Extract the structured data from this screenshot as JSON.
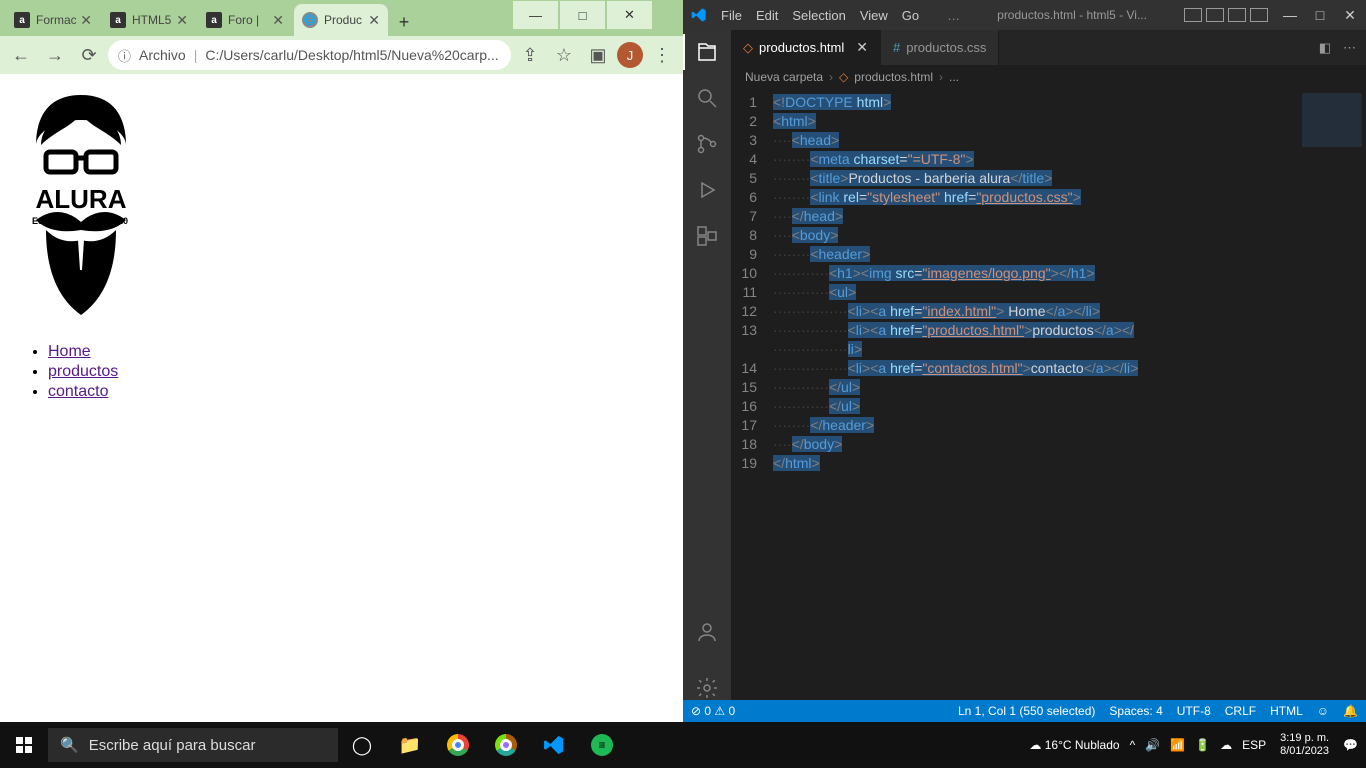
{
  "chrome": {
    "tabs": [
      {
        "title": "Formac",
        "icon": "a"
      },
      {
        "title": "HTML5",
        "icon": "a"
      },
      {
        "title": "Foro |",
        "icon": "a"
      },
      {
        "title": "Produc",
        "icon": "globe",
        "active": true
      }
    ],
    "url_label": "Archivo",
    "url": "C:/Users/carlu/Desktop/html5/Nueva%20carp...",
    "profile": "J",
    "nav": [
      {
        "text": " Home",
        "href": "index.html"
      },
      {
        "text": "productos",
        "href": "productos.html"
      },
      {
        "text": "contacto",
        "href": "contactos.html"
      }
    ],
    "logo": {
      "brand": "ALURA",
      "estd": "ESTD",
      "year": "2020"
    }
  },
  "vscode": {
    "menus": [
      "File",
      "Edit",
      "Selection",
      "View",
      "Go"
    ],
    "title": "productos.html - html5 - Vi...",
    "tabs": [
      {
        "name": "productos.html",
        "active": true
      },
      {
        "name": "productos.css",
        "css": true
      }
    ],
    "breadcrumb": [
      "Nueva carpeta",
      "productos.html",
      "..."
    ],
    "status": {
      "left": "⊘ 0 ⚠ 0",
      "pos": "Ln 1, Col 1 (550 selected)",
      "spaces": "Spaces: 4",
      "enc": "UTF-8",
      "eol": "CRLF",
      "lang": "HTML"
    },
    "code": [
      {
        "n": 1,
        "html": "<span class='sel'><span class='gray'>&lt;!</span><span class='blue'>DOCTYPE</span> <span class='lblue'>html</span><span class='gray'>&gt;</span></span>"
      },
      {
        "n": 2,
        "html": "<span class='sel'><span class='gray'>&lt;</span><span class='blue'>html</span><span class='gray'>&gt;</span></span>"
      },
      {
        "n": 3,
        "html": "<span class='dots'>····</span><span class='sel'><span class='gray'>&lt;</span><span class='blue'>head</span><span class='gray'>&gt;</span></span>"
      },
      {
        "n": 4,
        "html": "<span class='dots'>········</span><span class='sel'><span class='gray'>&lt;</span><span class='blue'>meta</span> <span class='lblue'>charset</span><span class='wh'>=</span><span class='str'>\"=UTF-8\"</span><span class='gray'>&gt;</span></span>"
      },
      {
        "n": 5,
        "html": "<span class='dots'>········</span><span class='sel'><span class='gray'>&lt;</span><span class='blue'>title</span><span class='gray'>&gt;</span><span class='wh'>Productos - barberia alura</span><span class='gray'>&lt;/</span><span class='blue'>title</span><span class='gray'>&gt;</span></span>"
      },
      {
        "n": 6,
        "html": "<span class='dots'>········</span><span class='sel'><span class='gray'>&lt;</span><span class='blue'>link</span> <span class='lblue'>rel</span><span class='wh'>=</span><span class='str'>\"stylesheet\"</span> <span class='lblue'>href</span><span class='wh'>=</span><span class='strlink'>\"productos.css\"</span><span class='gray'>&gt;</span></span>"
      },
      {
        "n": 7,
        "html": "<span class='dots'>····</span><span class='sel'><span class='gray'>&lt;/</span><span class='blue'>head</span><span class='gray'>&gt;</span></span>"
      },
      {
        "n": 8,
        "html": "<span class='dots'>····</span><span class='sel'><span class='gray'>&lt;</span><span class='blue'>body</span><span class='gray'>&gt;</span></span>"
      },
      {
        "n": 9,
        "html": "<span class='dots'>········</span><span class='sel'><span class='gray'>&lt;</span><span class='blue'>header</span><span class='gray'>&gt;</span></span>"
      },
      {
        "n": 10,
        "html": "<span class='dots'>············</span><span class='sel'><span class='gray'>&lt;</span><span class='blue'>h1</span><span class='gray'>&gt;&lt;</span><span class='blue'>img</span> <span class='lblue'>src</span><span class='wh'>=</span><span class='strlink'>\"imagenes/logo.png\"</span><span class='gray'>&gt;&lt;/</span><span class='blue'>h1</span><span class='gray'>&gt;</span></span>"
      },
      {
        "n": 11,
        "html": "<span class='dots'>············</span><span class='sel'><span class='gray'>&lt;</span><span class='blue'>ul</span><span class='gray'>&gt;</span></span>"
      },
      {
        "n": 12,
        "html": "<span class='dots'>················</span><span class='sel'><span class='gray'>&lt;</span><span class='blue'>li</span><span class='gray'>&gt;&lt;</span><span class='blue'>a</span> <span class='lblue'>href</span><span class='wh'>=</span><span class='strlink'>\"index.html\"</span><span class='gray'>&gt;</span><span class='wh'> Home</span><span class='gray'>&lt;/</span><span class='blue'>a</span><span class='gray'>&gt;&lt;/</span><span class='blue'>li</span><span class='gray'>&gt;</span></span>"
      },
      {
        "n": 13,
        "html": "<span class='dots'>················</span><span class='sel'><span class='gray'>&lt;</span><span class='blue'>li</span><span class='gray'>&gt;&lt;</span><span class='blue'>a</span> <span class='lblue'>href</span><span class='wh'>=</span><span class='strlink'>\"productos.html\"</span><span class='gray'>&gt;</span><span class='wh'>productos</span><span class='gray'>&lt;/</span><span class='blue'>a</span><span class='gray'>&gt;&lt;/</span></span>"
      },
      {
        "n": "",
        "html": "<span class='dots'>················</span><span class='sel'><span class='blue'>li</span><span class='gray'>&gt;</span></span>"
      },
      {
        "n": 14,
        "html": "<span class='dots'>················</span><span class='sel'><span class='gray'>&lt;</span><span class='blue'>li</span><span class='gray'>&gt;&lt;</span><span class='blue'>a</span> <span class='lblue'>href</span><span class='wh'>=</span><span class='strlink'>\"contactos.html\"</span><span class='gray'>&gt;</span><span class='wh'>contacto</span><span class='gray'>&lt;/</span><span class='blue'>a</span><span class='gray'>&gt;&lt;/</span><span class='blue'>li</span><span class='gray'>&gt;</span></span>"
      },
      {
        "n": 15,
        "html": "<span class='dots'>············</span><span class='sel'><span class='gray'>&lt;/</span><span class='blue'>ul</span><span class='gray'>&gt;</span></span>"
      },
      {
        "n": 16,
        "html": "<span class='dots'>············</span><span class='sel'><span class='gray'>&lt;/</span><span class='blue'>ul</span><span class='gray'>&gt;</span></span>"
      },
      {
        "n": 17,
        "html": "<span class='dots'>········</span><span class='sel'><span class='gray'>&lt;/</span><span class='blue'>header</span><span class='gray'>&gt;</span></span>"
      },
      {
        "n": 18,
        "html": "<span class='dots'>····</span><span class='sel'><span class='gray'>&lt;/</span><span class='blue'>body</span><span class='gray'>&gt;</span></span>"
      },
      {
        "n": 19,
        "html": "<span class='sel'><span class='gray'>&lt;/</span><span class='blue'>html</span><span class='gray'>&gt;</span></span>"
      }
    ]
  },
  "taskbar": {
    "search_placeholder": "Escribe aquí para buscar",
    "weather": "16°C  Nublado",
    "lang": "ESP",
    "time": "3:19 p. m.",
    "date": "8/01/2023"
  }
}
